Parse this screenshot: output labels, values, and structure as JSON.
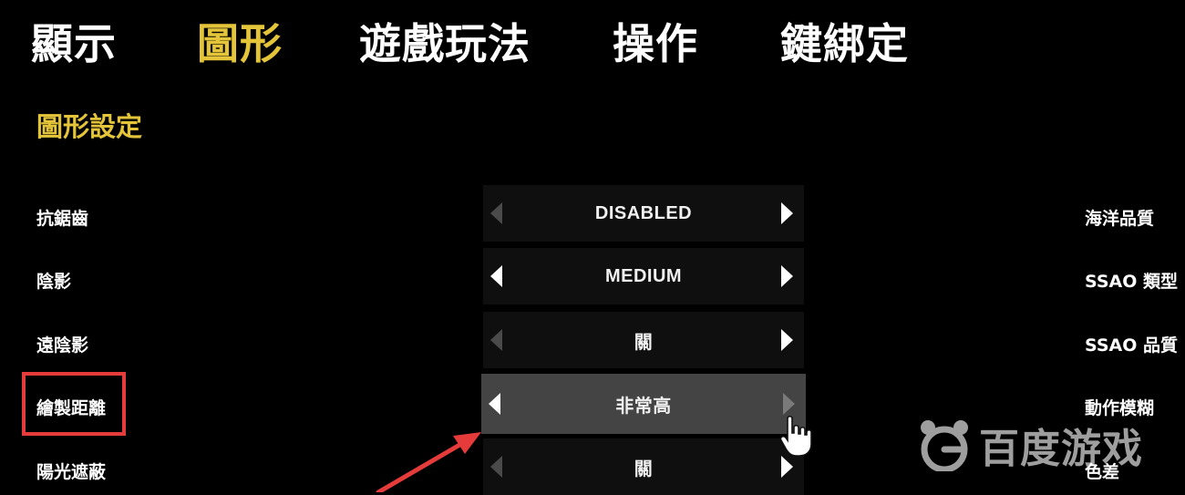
{
  "tabs": [
    {
      "label": "顯示",
      "active": false
    },
    {
      "label": "圖形",
      "active": true
    },
    {
      "label": "遊戲玩法",
      "active": false
    },
    {
      "label": "操作",
      "active": false
    },
    {
      "label": "鍵綁定",
      "active": false
    }
  ],
  "section_title": "圖形設定",
  "settings": [
    {
      "label": "抗鋸齒",
      "value": "DISABLED",
      "left_enabled": false,
      "right_enabled": true
    },
    {
      "label": "陰影",
      "value": "MEDIUM",
      "left_enabled": true,
      "right_enabled": true
    },
    {
      "label": "遠陰影",
      "value": "關",
      "left_enabled": false,
      "right_enabled": true
    },
    {
      "label": "繪製距離",
      "value": "非常高",
      "left_enabled": true,
      "right_enabled": false,
      "selected": true
    },
    {
      "label": "陽光遮蔽",
      "value": "關",
      "left_enabled": false,
      "right_enabled": true
    }
  ],
  "right_column": [
    "海洋品質",
    "SSAO 類型",
    "SSAO 品質",
    "動作模糊",
    "色差"
  ],
  "watermark": "百度游戏",
  "colors": {
    "accent": "#e4c53a",
    "background": "#000000",
    "annotation": "#e63b3b",
    "selected_row": "#444444"
  },
  "icons": {
    "left_arrow": "triangle-left-icon",
    "right_arrow": "triangle-right-icon",
    "cursor": "hand-pointer-icon",
    "watermark_logo": "baidu-paw-icon"
  }
}
